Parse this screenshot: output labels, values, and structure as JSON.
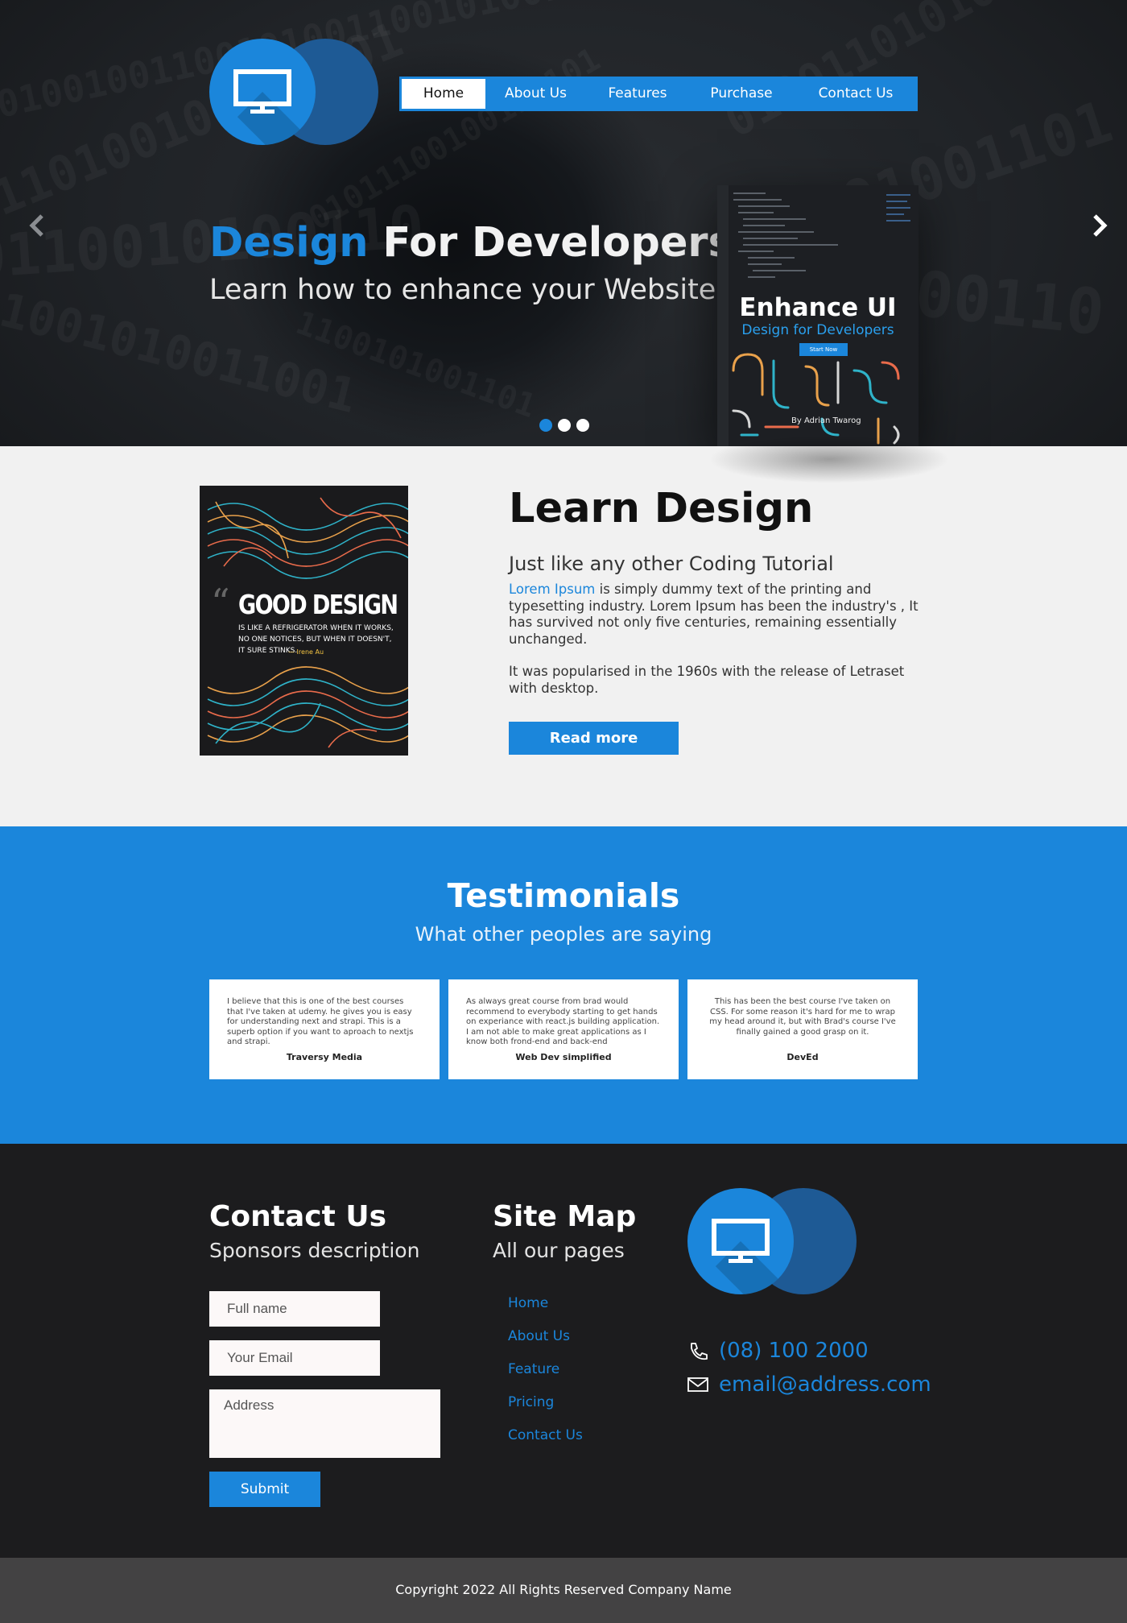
{
  "nav": {
    "items": [
      {
        "label": "Home",
        "active": true
      },
      {
        "label": "About Us",
        "active": false
      },
      {
        "label": "Features",
        "active": false
      },
      {
        "label": "Purchase",
        "active": false
      },
      {
        "label": "Contact Us",
        "active": false
      }
    ]
  },
  "hero": {
    "title_accent": "Design",
    "title_rest": " For Developers",
    "subtitle": "Learn how to enhance your Website",
    "prev_icon": "chevron-left-icon",
    "next_icon": "chevron-right-icon",
    "slides_count": 3,
    "active_slide": 1,
    "book": {
      "title": "Enhance UI",
      "subtitle": "Design for Developers",
      "button": "Start Now",
      "author": "By Adrian Twarog"
    }
  },
  "learn": {
    "poster": {
      "title": "GOOD DESIGN",
      "text": "IS LIKE A REFRIGERATOR WHEN IT WORKS, NO ONE NOTICES, BUT WHEN IT DOESN'T, IT SURE STINKS.",
      "author": "— Irene Au"
    },
    "title": "Learn Design",
    "subtitle": "Just like any other Coding Tutorial",
    "link_text": "Lorem Ipsum",
    "body": " is simply dummy text of the printing and typesetting industry. Lorem Ipsum has been the industry's , It has survived not only five centuries, remaining essentially unchanged.",
    "body2": " It was popularised in the 1960s with the release of Letraset with desktop.",
    "button": "Read more"
  },
  "testimonials": {
    "title": "Testimonials",
    "subtitle": "What other peoples are saying",
    "cards": [
      {
        "text": "I believe that this is one of the best courses that I've taken at udemy. he gives you is easy for understanding next and strapi. This is a superb option if you want to aproach to nextjs and strapi.",
        "author": "Traversy Media"
      },
      {
        "text": "As always great course from brad would recommend to everybody starting to get hands on experiance with react.js building application. I am not able to make great applications as I know both frond-end and back-end",
        "author": "Web Dev simplified"
      },
      {
        "text": "This has been the best course I've taken on CSS. For some reason it's hard for me to wrap my head around it, but with Brad's course I've finally gained a good grasp on it.",
        "author": "DevEd"
      }
    ]
  },
  "footer": {
    "contact_title": "Contact Us",
    "contact_sub": "Sponsors description",
    "fullname_placeholder": "Full name",
    "email_placeholder": "Your Email",
    "address_placeholder": "Address",
    "submit": "Submit",
    "sitemap_title": "Site Map",
    "sitemap_sub": "All our pages",
    "sitemap_links": [
      "Home",
      "About Us",
      "Feature",
      "Pricing",
      "Contact Us"
    ],
    "phone": "(08) 100 2000",
    "email": "email@address.com",
    "phone_icon": "phone-icon",
    "email_icon": "envelope-icon",
    "copyright": "Copyright 2022 All Rights Reserved Company Name"
  },
  "colors": {
    "accent": "#1b86db",
    "dark": "#1c1c1e",
    "light_bg": "#f1f1f1",
    "copyright_bg": "#434243"
  }
}
